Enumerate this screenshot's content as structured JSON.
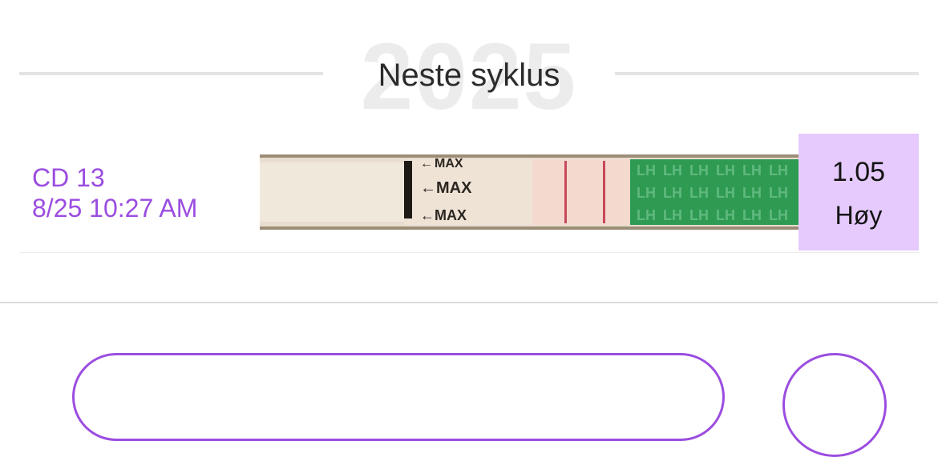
{
  "section": {
    "year": "2025",
    "title": "Neste syklus"
  },
  "test_entry": {
    "cycle_day": "CD 13",
    "datetime": "8/25 10:27 AM",
    "strip": {
      "icon": "lh-test-strip-photo",
      "max_label": "MAX",
      "brand_marks": [
        "LH",
        "LH",
        "LH",
        "LH",
        "LH",
        "LH",
        "LH",
        "LH",
        "LH",
        "LH",
        "LH",
        "LH",
        "LH",
        "LH",
        "LH",
        "LH",
        "LH",
        "LH"
      ]
    },
    "result": {
      "value": "1.05",
      "level": "Høy",
      "color": "#e6cafd"
    }
  },
  "colors": {
    "accent": "#9b4de0",
    "line": "#e4e4e4",
    "watermark": "#ececec"
  }
}
